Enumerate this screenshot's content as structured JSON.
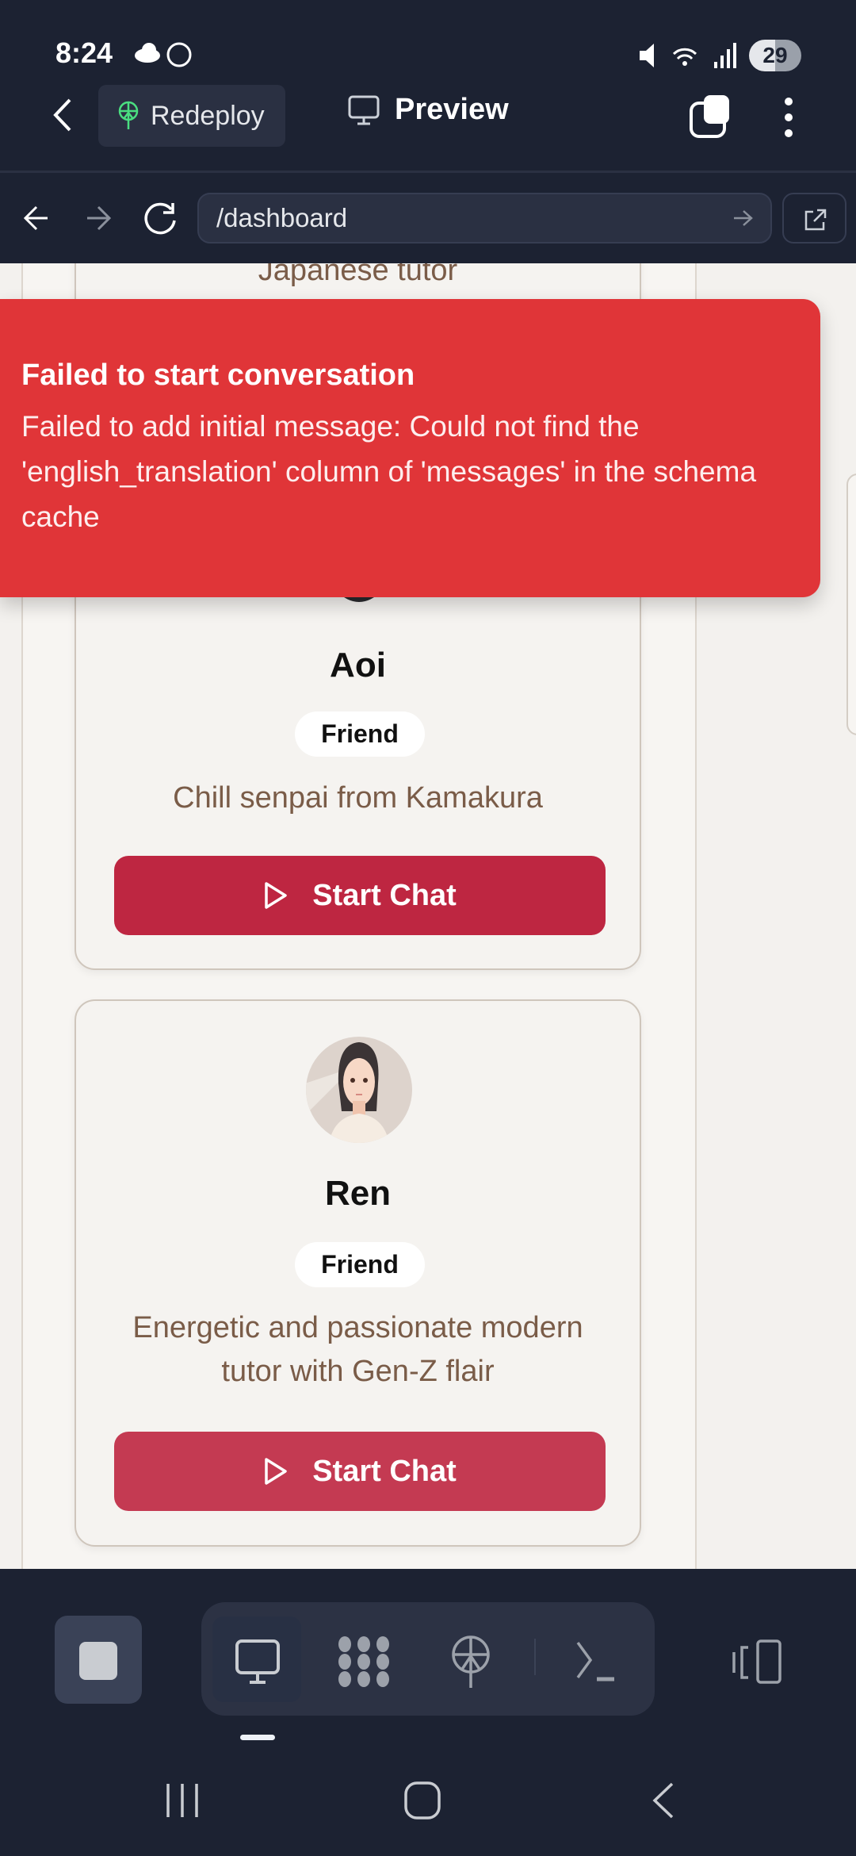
{
  "status_bar": {
    "time": "8:24",
    "battery": "29"
  },
  "app_bar": {
    "redeploy_label": "Redeploy",
    "preview_label": "Preview"
  },
  "browser": {
    "url": "/dashboard"
  },
  "cards": [
    {
      "description": "Japanese tutor",
      "name": "Aoi",
      "badge": "Friend",
      "description2": "Chill senpai from Kamakura",
      "button": "Start Chat"
    },
    {
      "name": "Ren",
      "badge": "Friend",
      "description_lines": [
        "Energetic and passionate modern",
        "tutor with Gen-Z flair"
      ],
      "button": "Start Chat"
    }
  ],
  "toast": {
    "title": "Failed to start conversation",
    "message": "Failed to add initial message: Could not find the 'english_translation' column of 'messages' in the schema cache"
  },
  "colors": {
    "toast": "#e03538",
    "button_primary": "#be2641",
    "button_secondary": "#c43a52",
    "accent_green": "#4ade80"
  }
}
